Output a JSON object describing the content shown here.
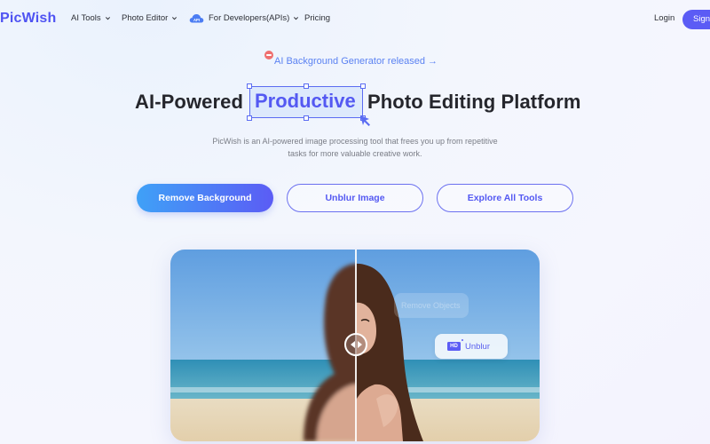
{
  "brand": {
    "name": "PicWish",
    "accent": "#5b5cf5",
    "accent_light": "#3fa1f7"
  },
  "nav": {
    "items": [
      {
        "label": "AI Tools",
        "has_dropdown": true
      },
      {
        "label": "Photo Editor",
        "has_dropdown": true
      },
      {
        "label": "For Developers(APIs)",
        "has_dropdown": true,
        "icon": "api-cloud-icon",
        "icon_text": "API"
      },
      {
        "label": "Pricing",
        "has_dropdown": false
      }
    ],
    "login_label": "Login",
    "signup_label": "Sign"
  },
  "announcement": {
    "badge": "new-badge-icon",
    "text": "AI Background Generator released →"
  },
  "hero": {
    "headline_before": "AI-Powered",
    "headline_highlight": "Productive",
    "headline_after": "Photo Editing Platform",
    "subtitle": "PicWish is an AI-powered image processing tool that frees you up from repetitive tasks for more valuable creative work.",
    "buttons": [
      {
        "label": "Remove Background",
        "style": "primary"
      },
      {
        "label": "Unblur Image",
        "style": "outline"
      },
      {
        "label": "Explore All Tools",
        "style": "outline"
      }
    ]
  },
  "preview": {
    "ghost_chip": "Remove Objects",
    "active_chip": {
      "icon_text": "HD",
      "label": "Unblur"
    },
    "comparison_split": 0.5
  }
}
